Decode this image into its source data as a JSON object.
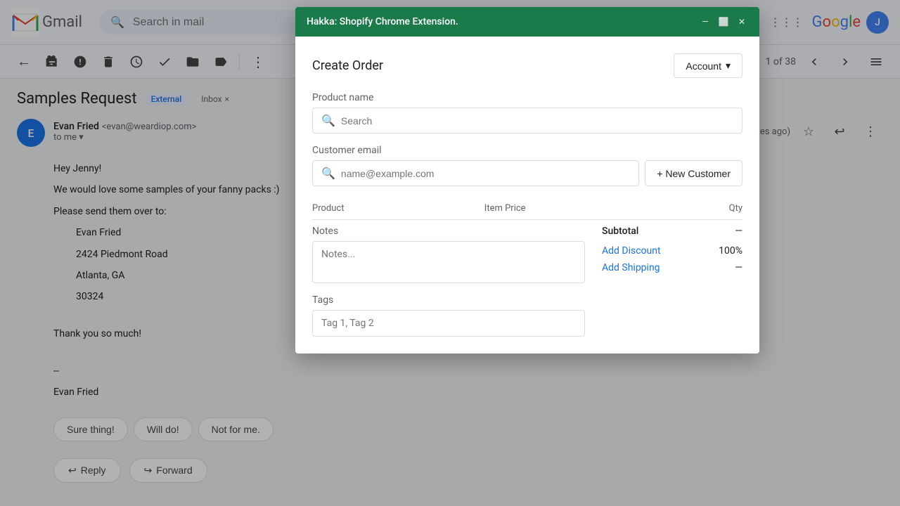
{
  "gmail": {
    "logo_text": "Gmail",
    "search_placeholder": "Search in mail"
  },
  "toolbar": {
    "back_label": "←",
    "archive_label": "⬜",
    "report_label": "🚫",
    "delete_label": "🗑",
    "delete_tooltip": "Delete",
    "snooze_label": "⏰",
    "mark_done_label": "✓",
    "move_label": "📁",
    "label_label": "🏷",
    "more_label": "⋮",
    "count_text": "1 of 38",
    "nav_prev": "‹",
    "nav_next": "›"
  },
  "email": {
    "subject": "Samples Request",
    "tag_external": "External",
    "tag_inbox": "Inbox",
    "tag_inbox_x": "×",
    "sender_name": "Evan Fried",
    "sender_email": "<evan@weardiop.com>",
    "sender_initial": "E",
    "to_me": "to me",
    "time_ago": "minutes ago)",
    "body_line1": "Hey Jenny!",
    "body_line2": "We would love some samples of your fanny packs :)",
    "body_line3": "Please send them over to:",
    "address_name": "Evan Fried",
    "address_line1": "2424 Piedmont Road",
    "address_line2": "Atlanta, GA",
    "address_line3": "30324",
    "body_line4": "Thank you so much!",
    "signature_sep": "--",
    "signature_name": "Evan Fried",
    "quick_reply_1": "Sure thing!",
    "quick_reply_2": "Will do!",
    "quick_reply_3": "Not for me.",
    "reply_btn": "Reply",
    "forward_btn": "Forward"
  },
  "shopify_modal": {
    "title": "Hakka: Shopify Chrome Extension.",
    "ctrl_minimize": "—",
    "ctrl_maximize": "⬜",
    "ctrl_close": "✕",
    "form_title": "Create Order",
    "account_btn": "Account",
    "product_name_label": "Product name",
    "product_search_placeholder": "Search",
    "customer_email_label": "Customer email",
    "customer_email_placeholder": "name@example.com",
    "new_customer_btn": "+ New Customer",
    "table_col_product": "Product",
    "table_col_price": "Item Price",
    "table_col_qty": "Qty",
    "notes_label": "Notes",
    "notes_placeholder": "Notes...",
    "tags_label": "Tags",
    "tags_placeholder": "Tag 1, Tag 2",
    "subtotal_label": "Subtotal",
    "subtotal_value": "—",
    "add_discount_link": "Add Discount",
    "discount_value": "100%",
    "add_shipping_link": "Add Shipping",
    "shipping_value": "—"
  },
  "google_logo": {
    "text": "Google"
  }
}
